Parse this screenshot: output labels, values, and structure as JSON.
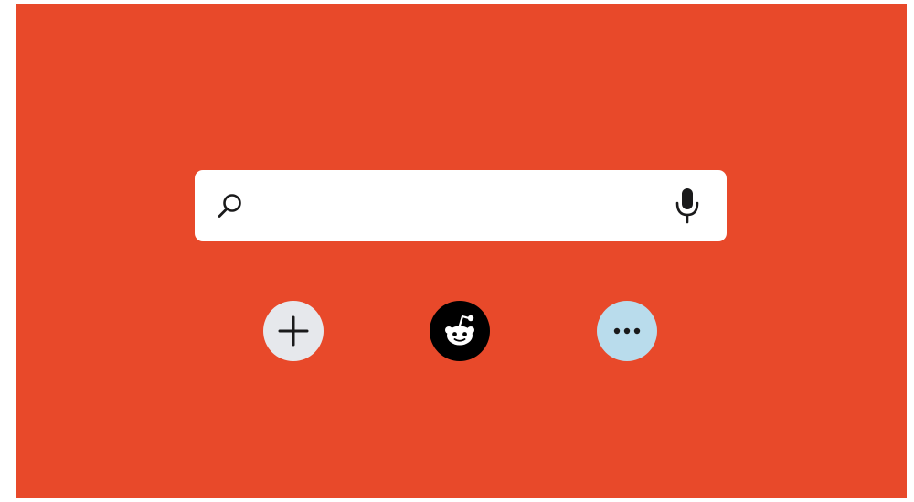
{
  "colors": {
    "background": "#e8492a",
    "search_bar": "#ffffff",
    "add_button": "#e6e8ec",
    "reddit_button": "#000000",
    "more_button": "#b9dcec",
    "icon": "#1a1a1b"
  },
  "search": {
    "value": "",
    "placeholder": "",
    "left_icon": "search-icon",
    "right_icon": "microphone-icon"
  },
  "actions": [
    {
      "icon": "plus-icon"
    },
    {
      "icon": "reddit-logo-icon"
    },
    {
      "icon": "more-horizontal-icon"
    }
  ]
}
